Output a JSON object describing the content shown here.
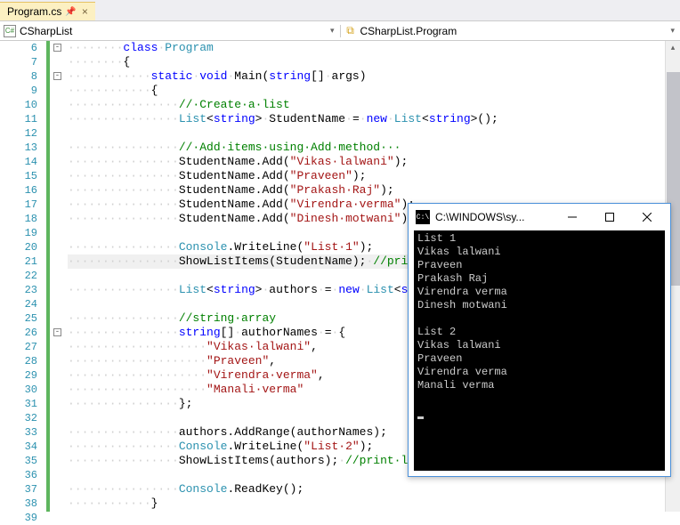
{
  "tab": {
    "filename": "Program.cs"
  },
  "nav": {
    "left": "CSharpList",
    "right": "CSharpList.Program"
  },
  "lines_start": 6,
  "lines_end": 39,
  "fold_markers": [
    {
      "line": 6,
      "glyph": "-"
    },
    {
      "line": 8,
      "glyph": "-"
    },
    {
      "line": 26,
      "glyph": "-"
    }
  ],
  "code": [
    {
      "n": 6,
      "t": [
        [
          "dots",
          "········"
        ],
        [
          "kw",
          "class"
        ],
        [
          "dots",
          "·"
        ],
        [
          "type",
          "Program"
        ]
      ]
    },
    {
      "n": 7,
      "t": [
        [
          "dots",
          "········"
        ],
        [
          "",
          "{"
        ]
      ]
    },
    {
      "n": 8,
      "t": [
        [
          "dots",
          "············"
        ],
        [
          "kw",
          "static"
        ],
        [
          "dots",
          "·"
        ],
        [
          "kw",
          "void"
        ],
        [
          "dots",
          "·"
        ],
        [
          "",
          "Main("
        ],
        [
          "kw",
          "string"
        ],
        [
          "",
          "[]"
        ],
        [
          "dots",
          "·"
        ],
        [
          "",
          "args)"
        ]
      ]
    },
    {
      "n": 9,
      "t": [
        [
          "dots",
          "············"
        ],
        [
          "",
          "{"
        ]
      ]
    },
    {
      "n": 10,
      "t": [
        [
          "dots",
          "················"
        ],
        [
          "cmt",
          "//·Create·a·list"
        ]
      ]
    },
    {
      "n": 11,
      "t": [
        [
          "dots",
          "················"
        ],
        [
          "type",
          "List"
        ],
        [
          "",
          "<"
        ],
        [
          "kw",
          "string"
        ],
        [
          "",
          ">"
        ],
        [
          "dots",
          "·"
        ],
        [
          "",
          "StudentName"
        ],
        [
          "dots",
          "·"
        ],
        [
          "",
          "="
        ],
        [
          "dots",
          "·"
        ],
        [
          "kw",
          "new"
        ],
        [
          "dots",
          "·"
        ],
        [
          "type",
          "List"
        ],
        [
          "",
          "<"
        ],
        [
          "kw",
          "string"
        ],
        [
          "",
          ">();"
        ]
      ]
    },
    {
      "n": 12,
      "t": [
        [
          "",
          ""
        ]
      ]
    },
    {
      "n": 13,
      "t": [
        [
          "dots",
          "················"
        ],
        [
          "cmt",
          "//·Add·items·using·Add·method···"
        ]
      ]
    },
    {
      "n": 14,
      "t": [
        [
          "dots",
          "················"
        ],
        [
          "",
          "StudentName.Add("
        ],
        [
          "str",
          "\"Vikas·lalwani\""
        ],
        [
          "",
          ");"
        ]
      ]
    },
    {
      "n": 15,
      "t": [
        [
          "dots",
          "················"
        ],
        [
          "",
          "StudentName.Add("
        ],
        [
          "str",
          "\"Praveen\""
        ],
        [
          "",
          ");"
        ]
      ]
    },
    {
      "n": 16,
      "t": [
        [
          "dots",
          "················"
        ],
        [
          "",
          "StudentName.Add("
        ],
        [
          "str",
          "\"Prakash·Raj\""
        ],
        [
          "",
          ");"
        ]
      ]
    },
    {
      "n": 17,
      "t": [
        [
          "dots",
          "················"
        ],
        [
          "",
          "StudentName.Add("
        ],
        [
          "str",
          "\"Virendra·verma\""
        ],
        [
          "",
          ");"
        ]
      ]
    },
    {
      "n": 18,
      "t": [
        [
          "dots",
          "················"
        ],
        [
          "",
          "StudentName.Add("
        ],
        [
          "str",
          "\"Dinesh·motwani\""
        ],
        [
          "",
          ");"
        ]
      ]
    },
    {
      "n": 19,
      "t": [
        [
          "",
          ""
        ]
      ]
    },
    {
      "n": 20,
      "t": [
        [
          "dots",
          "················"
        ],
        [
          "type",
          "Console"
        ],
        [
          "",
          ".WriteLine("
        ],
        [
          "str",
          "\"List·1\""
        ],
        [
          "",
          ");"
        ]
      ]
    },
    {
      "n": 21,
      "hl": true,
      "t": [
        [
          "dots",
          "················"
        ],
        [
          "",
          "ShowListItems(StudentName);"
        ],
        [
          "dots",
          "·"
        ],
        [
          "cmt",
          "//print·list·items"
        ]
      ]
    },
    {
      "n": 22,
      "t": [
        [
          "",
          ""
        ]
      ]
    },
    {
      "n": 23,
      "t": [
        [
          "dots",
          "················"
        ],
        [
          "type",
          "List"
        ],
        [
          "",
          "<"
        ],
        [
          "kw",
          "string"
        ],
        [
          "",
          ">"
        ],
        [
          "dots",
          "·"
        ],
        [
          "",
          "authors"
        ],
        [
          "dots",
          "·"
        ],
        [
          "",
          "="
        ],
        [
          "dots",
          "·"
        ],
        [
          "kw",
          "new"
        ],
        [
          "dots",
          "·"
        ],
        [
          "type",
          "List"
        ],
        [
          "",
          "<"
        ],
        [
          "kw",
          "string"
        ],
        [
          "",
          ">();"
        ]
      ]
    },
    {
      "n": 24,
      "t": [
        [
          "",
          ""
        ]
      ]
    },
    {
      "n": 25,
      "t": [
        [
          "dots",
          "················"
        ],
        [
          "cmt",
          "//string·array"
        ]
      ]
    },
    {
      "n": 26,
      "t": [
        [
          "dots",
          "················"
        ],
        [
          "kw",
          "string"
        ],
        [
          "",
          "[]"
        ],
        [
          "dots",
          "·"
        ],
        [
          "",
          "authorNames"
        ],
        [
          "dots",
          "·"
        ],
        [
          "",
          "="
        ],
        [
          "dots",
          "·"
        ],
        [
          "",
          "{"
        ]
      ]
    },
    {
      "n": 27,
      "t": [
        [
          "dots",
          "····················"
        ],
        [
          "str",
          "\"Vikas·lalwani\""
        ],
        [
          "",
          ","
        ]
      ]
    },
    {
      "n": 28,
      "t": [
        [
          "dots",
          "····················"
        ],
        [
          "str",
          "\"Praveen\""
        ],
        [
          "",
          ","
        ]
      ]
    },
    {
      "n": 29,
      "t": [
        [
          "dots",
          "····················"
        ],
        [
          "str",
          "\"Virendra·verma\""
        ],
        [
          "",
          ","
        ]
      ]
    },
    {
      "n": 30,
      "t": [
        [
          "dots",
          "····················"
        ],
        [
          "str",
          "\"Manali·verma\""
        ]
      ]
    },
    {
      "n": 31,
      "t": [
        [
          "dots",
          "················"
        ],
        [
          "",
          "};"
        ]
      ]
    },
    {
      "n": 32,
      "t": [
        [
          "",
          ""
        ]
      ]
    },
    {
      "n": 33,
      "t": [
        [
          "dots",
          "················"
        ],
        [
          "",
          "authors.AddRange(authorNames);"
        ]
      ]
    },
    {
      "n": 34,
      "t": [
        [
          "dots",
          "················"
        ],
        [
          "type",
          "Console"
        ],
        [
          "",
          ".WriteLine("
        ],
        [
          "str",
          "\"List·2\""
        ],
        [
          "",
          ");"
        ]
      ]
    },
    {
      "n": 35,
      "t": [
        [
          "dots",
          "················"
        ],
        [
          "",
          "ShowListItems(authors);"
        ],
        [
          "dots",
          "·"
        ],
        [
          "cmt",
          "//print·list·items"
        ]
      ]
    },
    {
      "n": 36,
      "t": [
        [
          "",
          ""
        ]
      ]
    },
    {
      "n": 37,
      "t": [
        [
          "dots",
          "················"
        ],
        [
          "type",
          "Console"
        ],
        [
          "",
          ".ReadKey();"
        ]
      ]
    },
    {
      "n": 38,
      "t": [
        [
          "dots",
          "············"
        ],
        [
          "",
          "}"
        ]
      ]
    },
    {
      "n": 39,
      "t": [
        [
          "",
          ""
        ]
      ]
    }
  ],
  "console": {
    "title": "C:\\WINDOWS\\sy...",
    "output": [
      "List 1",
      "Vikas lalwani",
      "Praveen",
      "Prakash Raj",
      "Virendra verma",
      "Dinesh motwani",
      "",
      "List 2",
      "Vikas lalwani",
      "Praveen",
      "Virendra verma",
      "Manali verma",
      ""
    ]
  }
}
